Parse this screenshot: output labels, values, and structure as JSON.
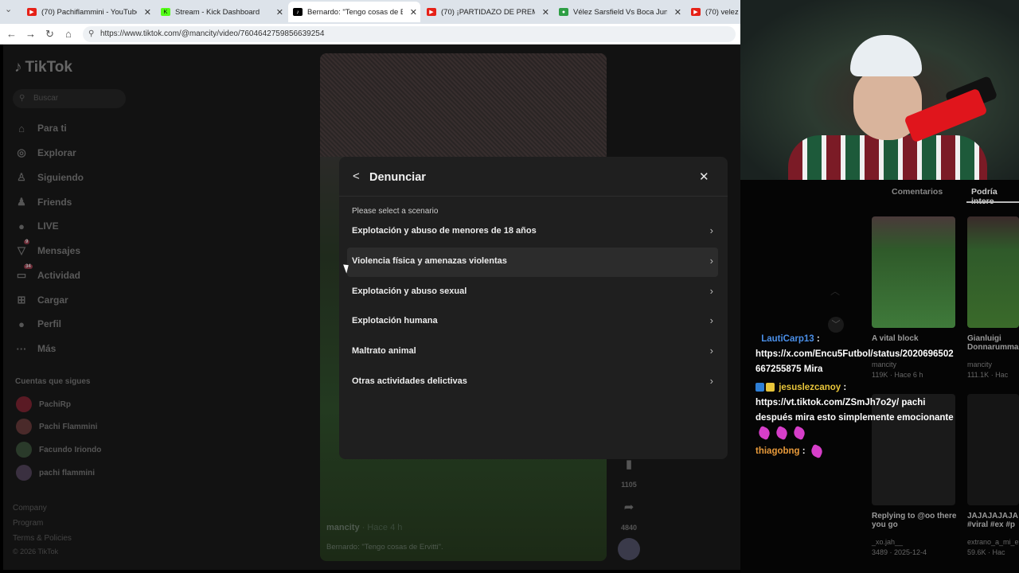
{
  "browser": {
    "tabs": [
      {
        "title": "(70) Pachiflammini - YouTube",
        "favicon": "youtube-icon",
        "color": "#e62117"
      },
      {
        "title": "Stream - Kick Dashboard",
        "favicon": "kick-icon",
        "color": "#53fc18"
      },
      {
        "title": "Bernardo: \"Tengo cosas de Ervitti\"",
        "favicon": "tiktok-icon",
        "color": "#000000"
      },
      {
        "title": "(70) ¡PARTIDAZO DE PREMIER! CC",
        "favicon": "youtube-icon",
        "color": "#e62117"
      },
      {
        "title": "Vélez Sarsfield Vs Boca Juniors - A",
        "favicon": "soccer-icon",
        "color": "#2e9e44"
      },
      {
        "title": "(70) velez vs",
        "favicon": "youtube-icon",
        "color": "#e62117"
      }
    ],
    "url": "https://www.tiktok.com/@mancity/video/7604642759856639254"
  },
  "tiktok": {
    "logo": "TikTok",
    "search_placeholder": "Buscar",
    "nav": [
      {
        "label": "Para ti",
        "icon": "home-icon",
        "glyph": "⌂"
      },
      {
        "label": "Explorar",
        "icon": "compass-icon",
        "glyph": "◎"
      },
      {
        "label": "Siguiendo",
        "icon": "following-icon",
        "glyph": "♙"
      },
      {
        "label": "Friends",
        "icon": "friends-icon",
        "glyph": "♟"
      },
      {
        "label": "LIVE",
        "icon": "live-icon",
        "glyph": "●"
      },
      {
        "label": "Mensajes",
        "icon": "messages-icon",
        "glyph": "▽",
        "badge": "9"
      },
      {
        "label": "Actividad",
        "icon": "activity-icon",
        "glyph": "▭",
        "badge": "34"
      },
      {
        "label": "Cargar",
        "icon": "upload-icon",
        "glyph": "⊞"
      },
      {
        "label": "Perfil",
        "icon": "profile-icon",
        "glyph": "●"
      },
      {
        "label": "Más",
        "icon": "more-icon",
        "glyph": "···"
      }
    ],
    "following_header": "Cuentas que sigues",
    "following": [
      "PachiRp",
      "Pachi Flammini",
      "Facundo Iriondo",
      "pachi flammini"
    ],
    "footer": [
      "Company",
      "Program",
      "Terms & Policies",
      "© 2026 TikTok"
    ],
    "video": {
      "author": "mancity",
      "time": "· Hace 4 h",
      "description": "Bernardo: \"Tengo cosas de Ervitti\".",
      "saves": "1105",
      "shares": "4840"
    }
  },
  "modal": {
    "title": "Denunciar",
    "hint": "Please select a scenario",
    "options": [
      "Explotación y abuso de menores de 18 años",
      "Violencia física y amenazas violentas",
      "Explotación y abuso sexual",
      "Explotación humana",
      "Maltrato animal",
      "Otras actividades delictivas"
    ]
  },
  "right_panel": {
    "tabs": [
      "Comentarios",
      "Podría intere"
    ],
    "videos": [
      {
        "caption": "A vital block",
        "author": "mancity",
        "stats": "119K · Hace 6 h"
      },
      {
        "caption": "Gianluigi Donnarumma",
        "author": "mancity",
        "stats": "111.1K · Hac"
      },
      {
        "caption": "Replying to @oo there you go",
        "author": "_xo.jah__",
        "stats": "3489 · 2025-12-4"
      },
      {
        "caption": "JAJAJAJAJA #viral #ex #p",
        "author": "extrano_a_mi_e",
        "stats": "59.6K · Hac"
      }
    ]
  },
  "chat": [
    {
      "user": "LautiCarp13",
      "user_color": "#4a8fe8",
      "text": "https://x.com/Encu5Futbol/status/2020696502667255875 Mira"
    },
    {
      "user": "jesuslezcanoy",
      "user_color": "#e8c53a",
      "text": "https://vt.tiktok.com/ZSmJh7o2y/ pachi después mira esto simplemente emocionante"
    },
    {
      "user": "thiagobng",
      "user_color": "#e89a3a",
      "text": ""
    }
  ]
}
